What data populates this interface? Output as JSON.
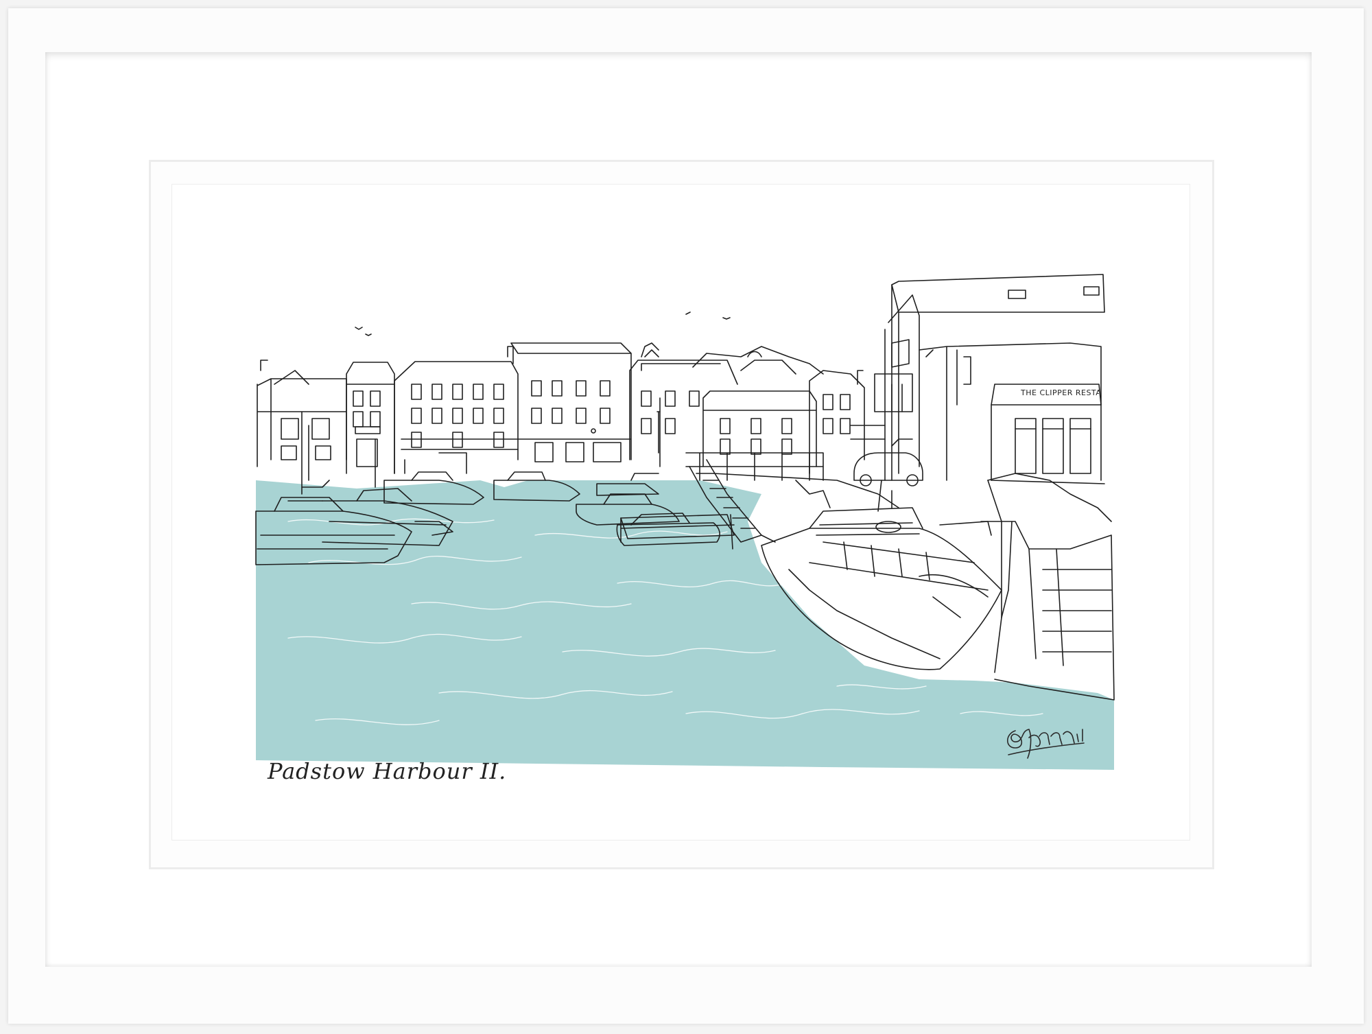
{
  "artwork": {
    "caption": "Padstow Harbour II.",
    "shop_sign": "THE CLIPPER RESTAURANT",
    "signature": "Sharon"
  },
  "colors": {
    "water": "#a8d3d3",
    "ink": "#1f1f1f",
    "frame": "#fcfcfc",
    "mat": "#ffffff"
  }
}
